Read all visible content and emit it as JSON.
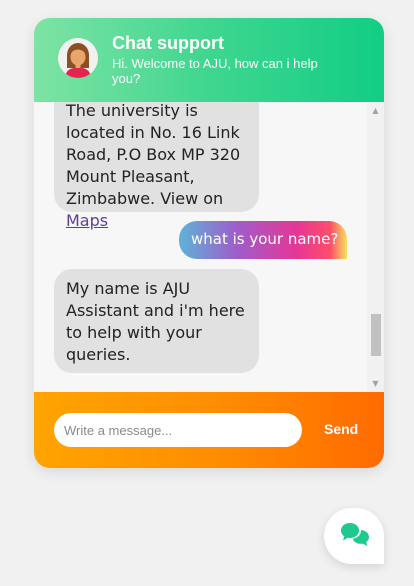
{
  "header": {
    "title": "Chat support",
    "subtitle": "Hi. Welcome to AJU, how can i help you?"
  },
  "messages": [
    {
      "sender": "bot",
      "text": "The university is located in No. 16 Link Road, P.O Box MP 320 Mount Pleasant, Zimbabwe. View on ",
      "link_text": "Maps"
    },
    {
      "sender": "user",
      "text": "what is your name?"
    },
    {
      "sender": "bot",
      "text": "My name is AJU Assistant and i'm here to help with your queries."
    }
  ],
  "composer": {
    "placeholder": "Write a message...",
    "value": "",
    "send_label": "Send"
  },
  "icons": {
    "avatar": "woman-avatar-icon",
    "launcher": "chat-bubbles-icon",
    "scroll_up": "scroll-up-arrow-icon",
    "scroll_down": "scroll-down-arrow-icon"
  },
  "colors": {
    "header_start": "#7ee3a4",
    "header_end": "#12cd85",
    "footer_start": "#ffa400",
    "footer_end": "#ff6a00",
    "bot_bubble": "#e1e1e1",
    "link": "#5a3e9b",
    "launcher_icon": "#1ec98d"
  }
}
